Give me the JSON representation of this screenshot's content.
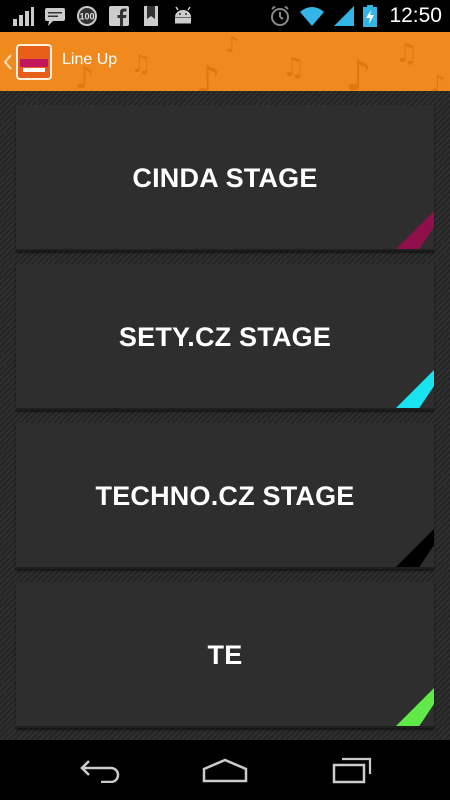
{
  "status_bar": {
    "time": "12:50",
    "left_icons": [
      "signal-bars-icon",
      "chat-icon",
      "badge-100-icon",
      "facebook-icon",
      "bookmark-icon",
      "android-icon"
    ],
    "right_icons": [
      "alarm-clock-icon",
      "wifi-icon",
      "cell-signal-icon",
      "battery-charging-icon"
    ],
    "badge_text": "100"
  },
  "action_bar": {
    "title": "Line Up",
    "background_color": "#f08a1e"
  },
  "stages": [
    {
      "label": "CINDA STAGE",
      "accent_color": "#8e0f4a"
    },
    {
      "label": "SETY.CZ STAGE",
      "accent_color": "#19e3ee"
    },
    {
      "label": "TECHNO.CZ STAGE",
      "accent_color": "#000000"
    },
    {
      "label": "TE",
      "accent_color": "#5fea4a"
    }
  ],
  "nav_bar": {
    "buttons": [
      "back-icon",
      "home-icon",
      "recent-apps-icon"
    ]
  }
}
